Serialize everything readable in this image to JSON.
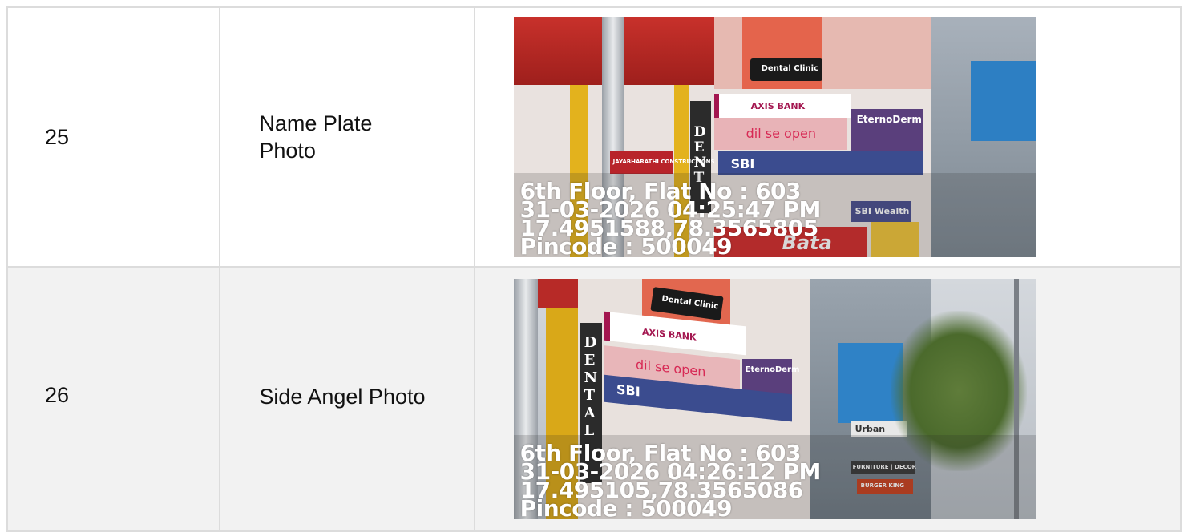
{
  "rows": [
    {
      "number": "25",
      "label_line1": "Name Plate",
      "label_line2": "Photo",
      "photo": {
        "stamp": [
          "6th Floor, Flat No : 603",
          "31-03-2026 04:25:47 PM",
          "17.4951588,78.3565805",
          "Pincode : 500049"
        ],
        "signs": {
          "dental": "Dental Clinic",
          "axis": "AXIS BANK",
          "open": "dil se open",
          "derm": "EternoDerm",
          "sbi": "SBI",
          "sbi_wealth": "SBI Wealth",
          "vertical": "DENT",
          "jaya": "JAYABHARATHI CONSTRUCTIONS",
          "bata": "Bata"
        }
      }
    },
    {
      "number": "26",
      "label": "Side Angel Photo",
      "photo": {
        "stamp": [
          "6th Floor, Flat No : 603",
          "31-03-2026 04:26:12 PM",
          "17.495105,78.3565086",
          "Pincode : 500049"
        ],
        "signs": {
          "dental": "Dental Clinic",
          "axis": "AXIS BANK",
          "open": "dil se open",
          "derm": "EternoDerm",
          "sbi": "SBI",
          "vertical": "DENTAL",
          "urban": "Urban",
          "furniture": "FURNITURE | DECOR",
          "burger": "BURGER KING"
        }
      }
    }
  ]
}
